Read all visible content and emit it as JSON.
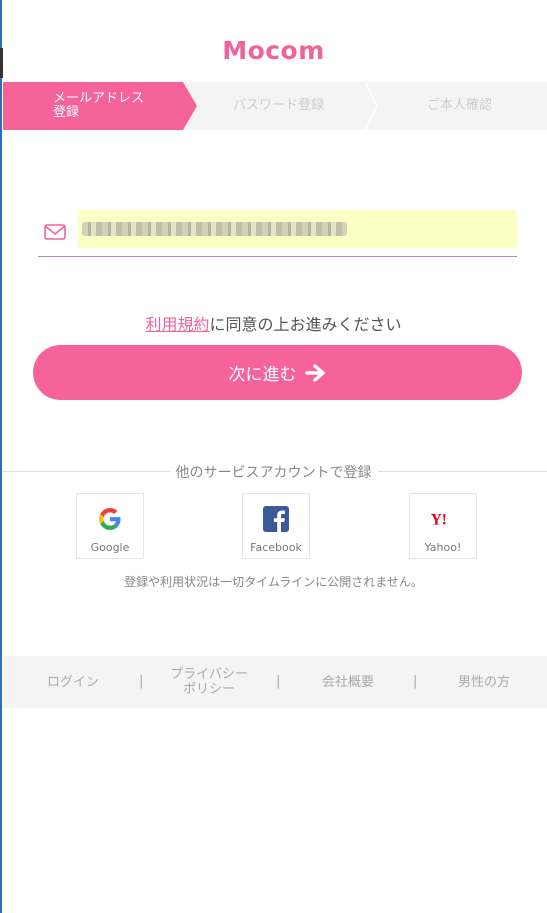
{
  "logo": {
    "text": "Mocom"
  },
  "steps": [
    {
      "label_line1": "メールアドレス",
      "label_line2": "登録",
      "active": true
    },
    {
      "label": "パスワード登録",
      "active": false
    },
    {
      "label": "ご本人確認",
      "active": false
    }
  ],
  "email": {
    "value": "",
    "icon": "envelope-icon"
  },
  "agreement": {
    "link": "利用規約",
    "text": "に同意の上お進みください"
  },
  "next_button": {
    "label": "次に進む",
    "icon": "arrow-right-icon"
  },
  "sns": {
    "heading": "他のサービスアカウントで登録",
    "buttons": [
      {
        "label": "Google",
        "icon": "google-icon"
      },
      {
        "label": "Facebook",
        "icon": "facebook-icon"
      },
      {
        "label": "Yahoo!",
        "icon": "yahoo-icon"
      }
    ],
    "note": "登録や利用状況は一切タイムラインに公開されません。"
  },
  "footer": {
    "links": [
      {
        "label": "ログイン"
      },
      {
        "label_line1": "プライバシー",
        "label_line2": "ポリシー"
      },
      {
        "label": "会社概要"
      },
      {
        "label": "男性の方"
      }
    ],
    "separator": "|"
  },
  "colors": {
    "accent": "#f6629a",
    "input_bg": "#fbffc4",
    "footer_bg": "#f4f4f4"
  }
}
